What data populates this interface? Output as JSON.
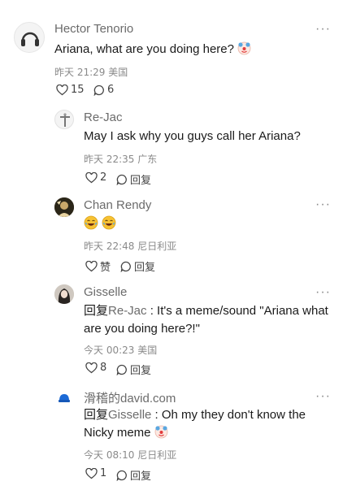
{
  "comments": [
    {
      "author": "Hector Tenorio",
      "text": "Ariana, what are you doing here?",
      "meta": "昨天 21:29 美国",
      "likes": "15",
      "replies": "6"
    },
    {
      "author": "Re-Jac",
      "text": "May I ask why you guys call her Ariana?",
      "meta": "昨天 22:35 广东",
      "likes": "2",
      "reply_label": "回复"
    },
    {
      "author": "Chan Rendy",
      "meta": "昨天 22:48 尼日利亚",
      "likes": "赞",
      "reply_label": "回复"
    },
    {
      "author": "Gisselle",
      "reply_prefix": "回复",
      "mention": "Re-Jac",
      "text": " : It's a meme/sound \"Ariana what are you doing here?!\"",
      "meta": "今天 00:23 美国",
      "likes": "8",
      "reply_label": "回复"
    },
    {
      "author": "滑稽的david.com",
      "reply_prefix": "回复",
      "mention": "Gisselle",
      "text": " : Oh my they don't know the Nicky meme",
      "meta": "今天 08:10 尼日利亚",
      "likes": "1",
      "reply_label": "回复"
    }
  ],
  "more_label": "···",
  "icons": {
    "like": "heart-outline-icon",
    "reply": "speech-bubble-icon",
    "more": "more-dots-icon"
  }
}
